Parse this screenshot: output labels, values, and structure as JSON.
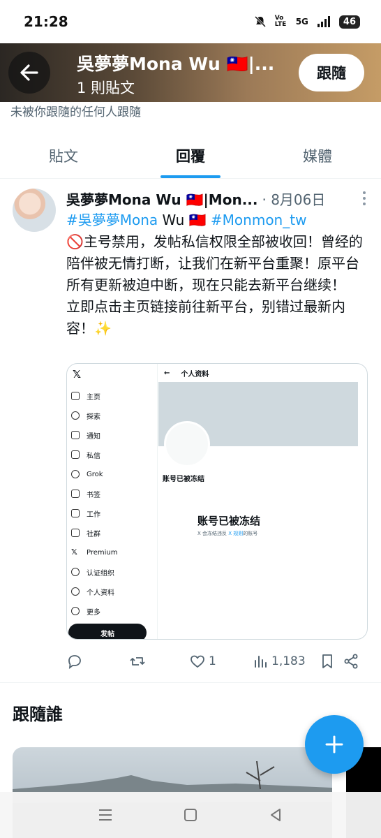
{
  "status_bar": {
    "time": "21:28",
    "network": "5G",
    "volte": "Vo LTE",
    "battery": "46"
  },
  "header": {
    "back_icon": "arrow-left-icon",
    "title": "吳夢夢Mona Wu 🇹🇼|...",
    "subtitle": "1 則貼文",
    "follow_label": "跟隨"
  },
  "profile": {
    "not_followed_text": "未被你跟隨的任何人跟隨"
  },
  "tabs": [
    {
      "label": "貼文",
      "active": false
    },
    {
      "label": "回覆",
      "active": true
    },
    {
      "label": "媒體",
      "active": false
    }
  ],
  "tweet": {
    "name": "吳夢夢Mona Wu 🇹🇼|Mon...",
    "date": "· 8月06日",
    "tag1": "#吳夢夢Mona",
    "tag_mid": " Wu 🇹🇼 ",
    "tag2": "#Monmon_tw",
    "line1": "🚫主号禁用，发帖私信权限全部被收回！曾经的陪伴被无情打断，让我们在新平台重聚！原平台所有更新被迫中断，现在只能去新平台继续！",
    "line2": "立即点击主页链接前往新平台，别错过最新内容！✨",
    "media": {
      "logo": "𝕏",
      "nav": [
        "主页",
        "探索",
        "通知",
        "私信",
        "Grok",
        "书签",
        "工作",
        "社群",
        "Premium",
        "认证组织",
        "个人资料",
        "更多"
      ],
      "post_button": "发帖",
      "back_arrow": "←",
      "page_title": "个人资料",
      "frozen_small": "账号已被冻结",
      "frozen_big": "账号已被冻结",
      "frozen_note_a": "X 会冻结违反 ",
      "frozen_note_link": "X 规则",
      "frozen_note_b": "的账号"
    },
    "actions": {
      "reply_count": "",
      "retweet_count": "",
      "like_count": "1",
      "view_count": "1,183"
    }
  },
  "who_to_follow": {
    "title": "跟隨誰"
  },
  "fab_icon": "plus-icon",
  "colors": {
    "accent": "#1d9bf0",
    "text": "#0f1419",
    "muted": "#536471"
  }
}
